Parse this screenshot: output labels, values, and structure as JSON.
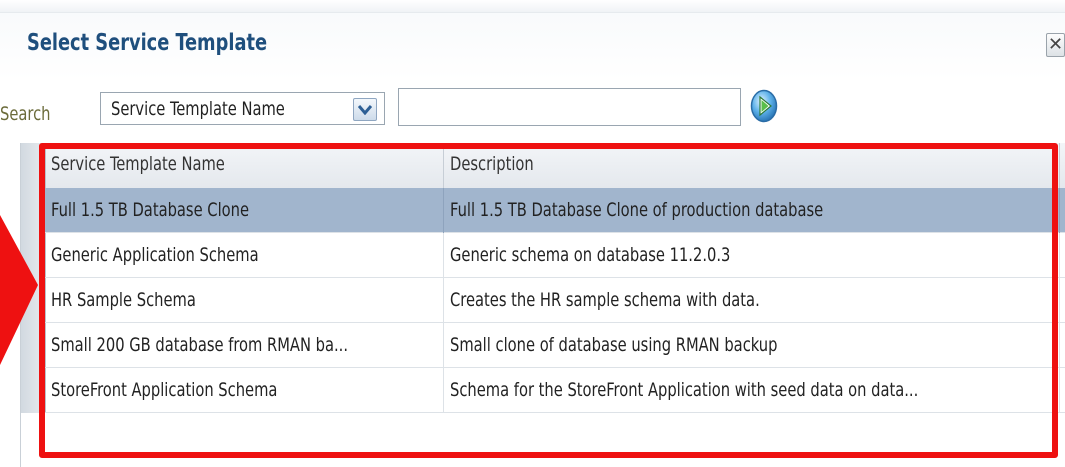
{
  "dialog": {
    "title": "Select Service Template",
    "close_glyph": "✕"
  },
  "search": {
    "label": "Search",
    "field_selected": "Service Template Name",
    "query_value": "",
    "go_icon": "go-arrow-icon"
  },
  "table": {
    "columns": [
      "Service Template Name",
      "Description"
    ],
    "rows": [
      {
        "name": "Full 1.5 TB Database Clone",
        "description": "Full 1.5 TB Database Clone of production database",
        "selected": true
      },
      {
        "name": "Generic Application Schema",
        "description": "Generic schema on database 11.2.0.3",
        "selected": false
      },
      {
        "name": "HR Sample Schema",
        "description": "Creates the HR sample schema with data.",
        "selected": false
      },
      {
        "name": "Small 200 GB database from RMAN ba...",
        "description": "Small clone of database using RMAN backup",
        "selected": false
      },
      {
        "name": "StoreFront Application Schema",
        "description": "Schema for the StoreFront Application with seed data on data...",
        "selected": false
      }
    ]
  },
  "colors": {
    "title": "#1f4f7d",
    "selected_row": "#a1b5cd",
    "highlight": "#ee1111",
    "go_button": "#3a8fd0"
  }
}
